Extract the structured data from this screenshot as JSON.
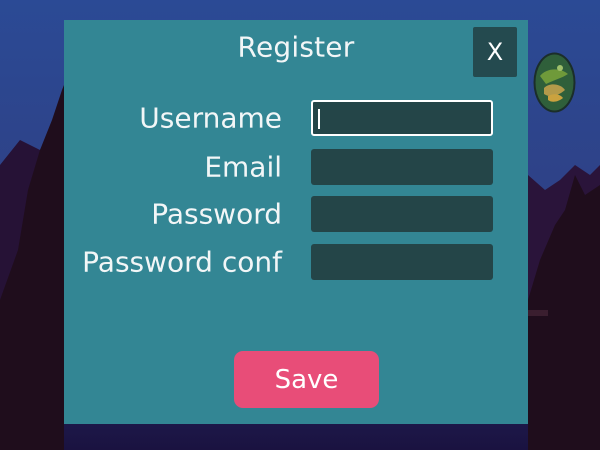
{
  "dialog": {
    "title": "Register",
    "close_label": "X",
    "fields": [
      {
        "label": "Username",
        "value": "",
        "placeholder": ""
      },
      {
        "label": "Email",
        "value": "",
        "placeholder": ""
      },
      {
        "label": "Password",
        "value": "",
        "placeholder": ""
      },
      {
        "label": "Password conf",
        "value": "",
        "placeholder": ""
      }
    ],
    "save_label": "Save"
  },
  "theme": {
    "dialog_bg": "#338694",
    "field_bg": "#244548",
    "accent": "#e84d78",
    "close_bg": "#244a4f",
    "text": "#f2f6f7"
  },
  "scene": {
    "mountains_color": "#1f0d1c",
    "sky_color": "#283a7a"
  }
}
